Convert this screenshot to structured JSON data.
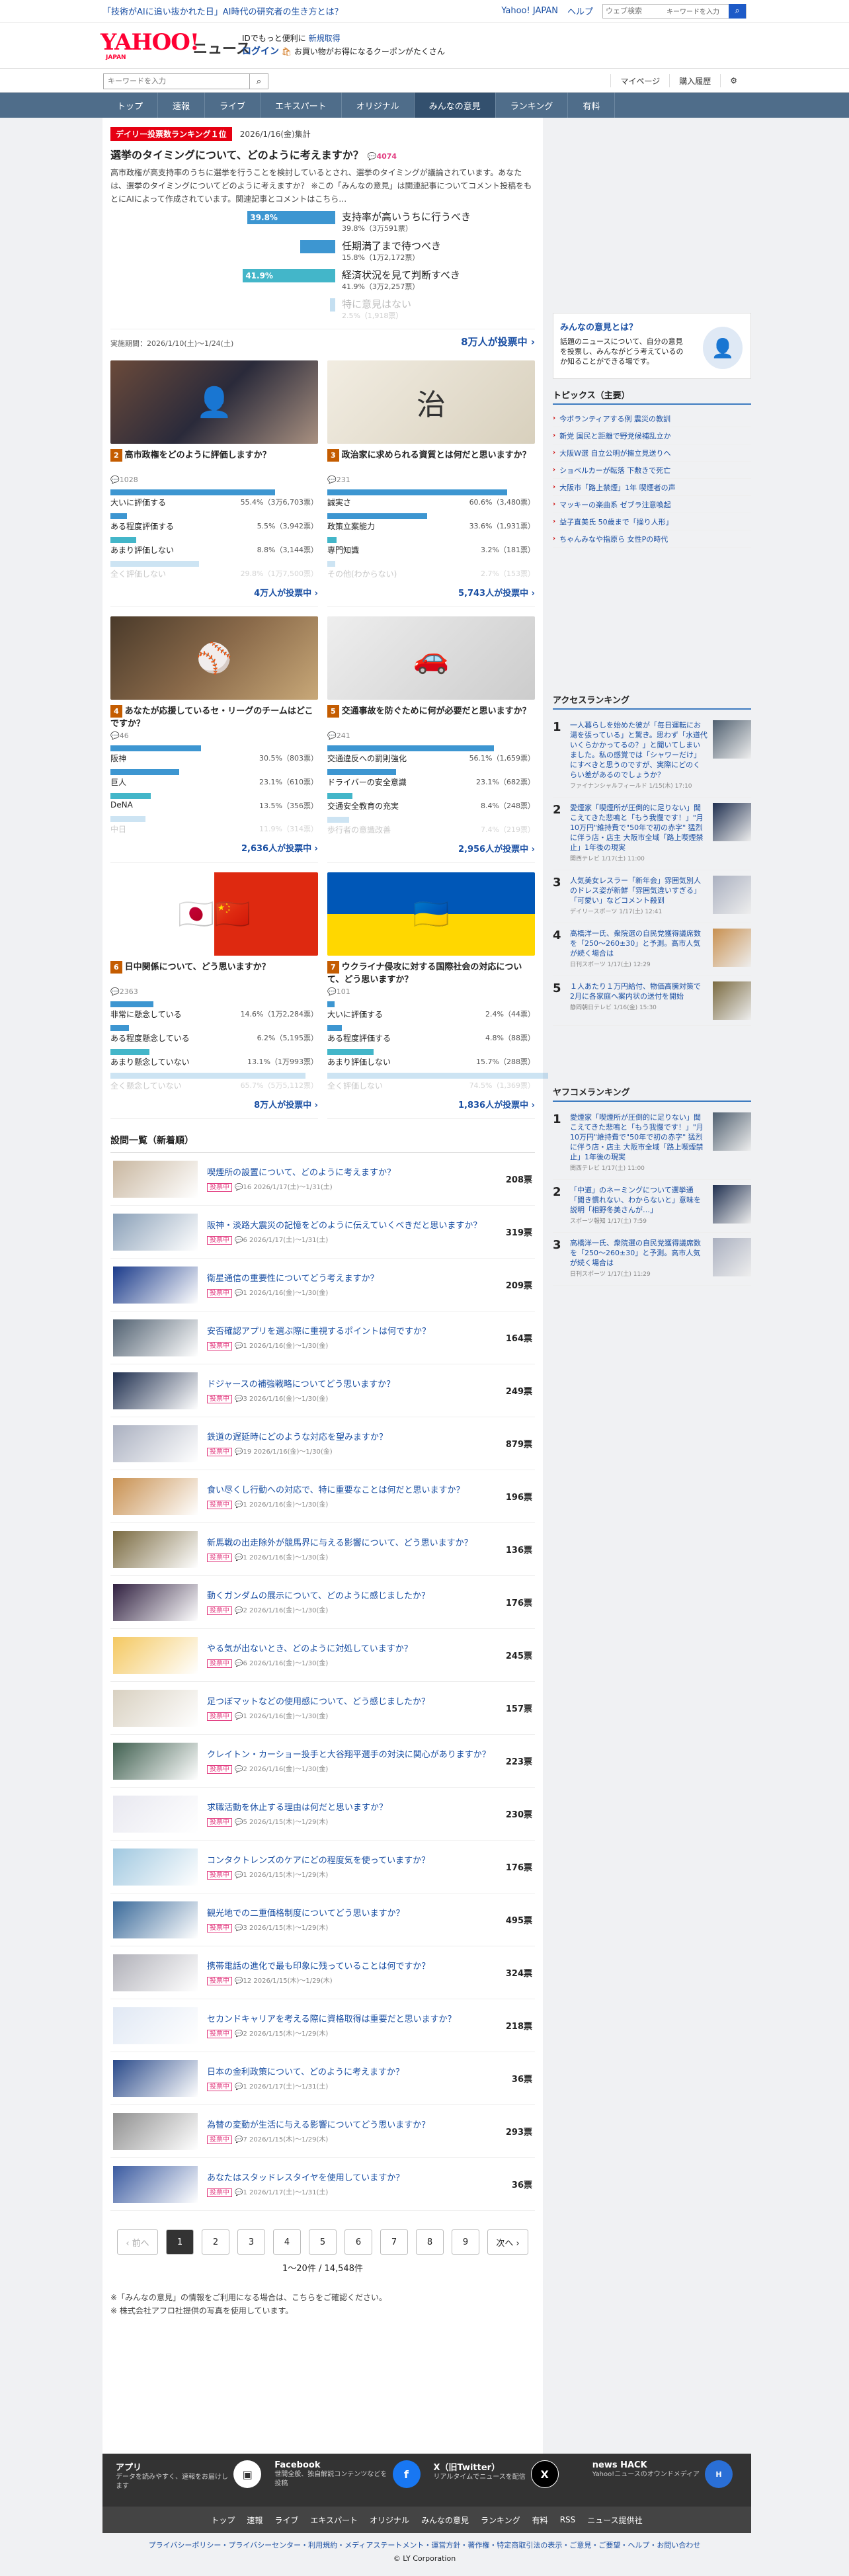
{
  "topbar": {
    "notice": "「技術がAIに追い抜かれた日」AI時代の研究者の生き方とは？",
    "japan": "Yahoo! JAPAN",
    "help": "ヘルプ",
    "search_placeholder": "ウェブ検索",
    "search_keyword": "キーワードを入力"
  },
  "header": {
    "logo": "YAHOO!",
    "logo_sub": "JAPAN",
    "news": "ニュース",
    "promo1": "IDでもっと便利に",
    "promo_new": "新規取得",
    "login": "ログイン",
    "promo2": "お買い物がお得になるクーポンがたくさん"
  },
  "searchbar": {
    "placeholder": "キーワードを入力",
    "mypage": "マイページ",
    "history": "購入履歴"
  },
  "nav": [
    "トップ",
    "速報",
    "ライブ",
    "エキスパート",
    "オリジナル",
    "みんなの意見",
    "ランキング",
    "有料"
  ],
  "feature": {
    "tag": "デイリー投票数ランキング１位",
    "date": "2026/1/16(金)集計",
    "title": "選挙のタイミングについて、どのように考えますか？",
    "comments": "4074",
    "description": "高市政権が高支持率のうちに選挙を行うことを検討しているとされ、選挙のタイミングが議論されています。あなたは、選挙のタイミングについてどのように考えますか？ ※この「みんなの意見」は関連記事についてコメント投稿をもとにAIによって作成されています。関連記事とコメントはこちら…",
    "options": [
      {
        "label": "支持率が高いうちに行うべき",
        "pct": 39.8,
        "pct_label": "39.8%",
        "value": "39.8%（3万591票）"
      },
      {
        "label": "任期満了まで待つべき",
        "pct": 15.8,
        "pct_label": "",
        "value": "15.8%（1万2,172票）"
      },
      {
        "label": "経済状況を見て判断すべき",
        "pct": 41.9,
        "pct_label": "41.9%",
        "value": "41.9%（3万2,257票）"
      },
      {
        "label": "特に意見はない",
        "pct": 2.5,
        "pct_label": "",
        "value": "2.5%（1,918票）"
      }
    ],
    "period": "実施期間：2026/1/10(土)〜1/24(土)",
    "votes": "8万人が投票中 ›"
  },
  "cards": [
    {
      "rank": "2",
      "title": "高市政権をどのように評価しますか？",
      "cmt": "1028",
      "opts": [
        {
          "l": "大いに評価する",
          "v": "55.4%（3万6,703票）",
          "p": 55.4
        },
        {
          "l": "ある程度評価する",
          "v": "5.5%（3,942票）",
          "p": 5.5
        },
        {
          "l": "あまり評価しない",
          "v": "8.8%（3,144票）",
          "p": 8.8
        },
        {
          "l": "全く評価しない",
          "v": "29.8%（1万7,500票）",
          "p": 29.8
        }
      ],
      "votes": "4万人が投票中 ›"
    },
    {
      "rank": "3",
      "title": "政治家に求められる資質とは何だと思いますか？",
      "cmt": "231",
      "opts": [
        {
          "l": "誠実さ",
          "v": "60.6%（3,480票）",
          "p": 60.6
        },
        {
          "l": "政策立案能力",
          "v": "33.6%（1,931票）",
          "p": 33.6
        },
        {
          "l": "専門知識",
          "v": "3.2%（181票）",
          "p": 3.2
        },
        {
          "l": "その他(わからない)",
          "v": "2.7%（153票）",
          "p": 2.7
        }
      ],
      "votes": "5,743人が投票中 ›"
    },
    {
      "rank": "4",
      "title": "あなたが応援しているセ・リーグのチームはどこですか？",
      "cmt": "46",
      "opts": [
        {
          "l": "阪神",
          "v": "30.5%（803票）",
          "p": 30.5
        },
        {
          "l": "巨人",
          "v": "23.1%（610票）",
          "p": 23.1
        },
        {
          "l": "DeNA",
          "v": "13.5%（356票）",
          "p": 13.5
        },
        {
          "l": "中日",
          "v": "11.9%（314票）",
          "p": 11.9
        }
      ],
      "votes": "2,636人が投票中 ›"
    },
    {
      "rank": "5",
      "title": "交通事故を防ぐために何が必要だと思いますか？",
      "cmt": "241",
      "opts": [
        {
          "l": "交通違反への罰則強化",
          "v": "56.1%（1,659票）",
          "p": 56.1
        },
        {
          "l": "ドライバーの安全意識",
          "v": "23.1%（682票）",
          "p": 23.1
        },
        {
          "l": "交通安全教育の充実",
          "v": "8.4%（248票）",
          "p": 8.4
        },
        {
          "l": "歩行者の意識改善",
          "v": "7.4%（219票）",
          "p": 7.4
        }
      ],
      "votes": "2,956人が投票中 ›"
    },
    {
      "rank": "6",
      "title": "日中関係について、どう思いますか？",
      "cmt": "2363",
      "opts": [
        {
          "l": "非常に懸念している",
          "v": "14.6%（1万2,284票）",
          "p": 14.6
        },
        {
          "l": "ある程度懸念している",
          "v": "6.2%（5,195票）",
          "p": 6.2
        },
        {
          "l": "あまり懸念していない",
          "v": "13.1%（1万993票）",
          "p": 13.1
        },
        {
          "l": "全く懸念していない",
          "v": "65.7%（5万5,112票）",
          "p": 65.7
        }
      ],
      "votes": "8万人が投票中 ›"
    },
    {
      "rank": "7",
      "title": "ウクライナ侵攻に対する国際社会の対応について、どう思いますか？",
      "cmt": "101",
      "opts": [
        {
          "l": "大いに評価する",
          "v": "2.4%（44票）",
          "p": 2.4
        },
        {
          "l": "ある程度評価する",
          "v": "4.8%（88票）",
          "p": 4.8
        },
        {
          "l": "あまり評価しない",
          "v": "15.7%（288票）",
          "p": 15.7
        },
        {
          "l": "全く評価しない",
          "v": "74.5%（1,369票）",
          "p": 74.5
        }
      ],
      "votes": "1,836人が投票中 ›"
    }
  ],
  "list": {
    "header": "設問一覧（新着順）",
    "items": [
      {
        "t": "喫煙所の設置について、どのように考えますか？",
        "m": "16 2026/1/17(土)〜1/31(土)",
        "v": "208票"
      },
      {
        "t": "阪神・淡路大震災の記憶をどのように伝えていくべきだと思いますか？",
        "m": "6 2026/1/17(土)〜1/31(土)",
        "v": "319票"
      },
      {
        "t": "衛星通信の重要性についてどう考えますか？",
        "m": "1 2026/1/16(金)〜1/30(金)",
        "v": "209票"
      },
      {
        "t": "安否確認アプリを選ぶ際に重視するポイントは何ですか？",
        "m": "1 2026/1/16(金)〜1/30(金)",
        "v": "164票"
      },
      {
        "t": "ドジャースの補強戦略についてどう思いますか？",
        "m": "3 2026/1/16(金)〜1/30(金)",
        "v": "249票"
      },
      {
        "t": "鉄道の遅延時にどのような対応を望みますか？",
        "m": "19 2026/1/16(金)〜1/30(金)",
        "v": "879票"
      },
      {
        "t": "食い尽くし行動への対応で、特に重要なことは何だと思いますか？",
        "m": "1 2026/1/16(金)〜1/30(金)",
        "v": "196票"
      },
      {
        "t": "新馬戦の出走除外が競馬界に与える影響について、どう思いますか？",
        "m": "1 2026/1/16(金)〜1/30(金)",
        "v": "136票"
      },
      {
        "t": "動くガンダムの展示について、どのように感じましたか？",
        "m": "2 2026/1/16(金)〜1/30(金)",
        "v": "176票"
      },
      {
        "t": "やる気が出ないとき、どのように対処していますか？",
        "m": "6 2026/1/16(金)〜1/30(金)",
        "v": "245票"
      },
      {
        "t": "足つぼマットなどの使用感について、どう感じましたか？",
        "m": "1 2026/1/16(金)〜1/30(金)",
        "v": "157票"
      },
      {
        "t": "クレイトン・カーショー投手と大谷翔平選手の対決に関心がありますか？",
        "m": "2 2026/1/16(金)〜1/30(金)",
        "v": "223票"
      },
      {
        "t": "求職活動を休止する理由は何だと思いますか？",
        "m": "5 2026/1/15(木)〜1/29(木)",
        "v": "230票"
      },
      {
        "t": "コンタクトレンズのケアにどの程度気を使っていますか？",
        "m": "1 2026/1/15(木)〜1/29(木)",
        "v": "176票"
      },
      {
        "t": "観光地での二重価格制度についてどう思いますか？",
        "m": "3 2026/1/15(木)〜1/29(木)",
        "v": "495票"
      },
      {
        "t": "携帯電話の進化で最も印象に残っていることは何ですか？",
        "m": "12 2026/1/15(木)〜1/29(木)",
        "v": "324票"
      },
      {
        "t": "セカンドキャリアを考える際に資格取得は重要だと思いますか？",
        "m": "2 2026/1/15(木)〜1/29(木)",
        "v": "218票"
      },
      {
        "t": "日本の金利政策について、どのように考えますか？",
        "m": "1 2026/1/17(土)〜1/31(土)",
        "v": "36票"
      },
      {
        "t": "為替の変動が生活に与える影響についてどう思いますか？",
        "m": "7 2026/1/15(木)〜1/29(木)",
        "v": "293票"
      },
      {
        "t": "あなたはスタッドレスタイヤを使用していますか？",
        "m": "1 2026/1/17(土)〜1/31(土)",
        "v": "36票"
      }
    ],
    "status": "投票中"
  },
  "pager": {
    "prev": "‹ 前へ",
    "pages": [
      "1",
      "2",
      "3",
      "4",
      "5",
      "6",
      "7",
      "8",
      "9"
    ],
    "next": "次へ ›",
    "count": "1〜20件 / 14,548件"
  },
  "notes": [
    "※「みんなの意見」の情報をご利用になる場合は、こちらをご確認ください。",
    "※ 株式会社アフロ社提供の写真を使用しています。"
  ],
  "side": {
    "about_title": "みんなの意見とは？",
    "about_text": "話題のニュースについて、自分の意見を投票し、みんながどう考えているのか知ることができる場です。",
    "topics_title": "トピックス（主要）",
    "topics": [
      "今ボランティアする例 震災の教訓",
      "新党 国民と距離で野党候補乱立か",
      "大阪W選 自立公明が擁立見送りへ",
      "ショベルカーが転落 下敷きで死亡",
      "大阪市「路上禁煙」1年 喫煙者の声",
      "マッキーの楽曲系 ゼブラ注意喚起",
      "益子直美氏 50歳まで「操り人形」",
      "ちゃんみなや指原ら 女性Pの時代"
    ],
    "access_title": "アクセスランキング",
    "access": [
      {
        "t": "一人暮らしを始めた彼が「毎日運転にお湯を張っている」と驚き。思わず「水道代いくらかかってるの？」と聞いてしまいました。私の感覚では「シャワーだけ」にすべきと思うのですが、実際にどのくらい差があるのでしょうか？",
        "m": "ファイナンシャルフィールド 1/15(木) 17:10"
      },
      {
        "t": "愛煙家「喫煙所が圧倒的に足りない」聞こえてきた悲鳴と「もう我慢です！」\"月10万円\"維持費で\"50年で初の赤字\" 猛烈に伴う店・店主 大阪市全域「路上喫煙禁止」1年後の現実",
        "m": "関西テレビ 1/17(土) 11:00"
      },
      {
        "t": "人気美女レスラー「新年会」雰囲気別人のドレス姿が新鮮「雰囲気違いすぎる」「可愛い」などコメント殺到",
        "m": "デイリースポーツ 1/17(土) 12:41"
      },
      {
        "t": "高橋洋一氏、衆院選の自民党獲得議席数を「250〜260±30」と予測。高市人気が続く場合は",
        "m": "日刊スポーツ 1/17(土) 12:29"
      },
      {
        "t": "１人あたり１万円給付、物価高騰対策で 2月に各家庭へ案内状の送付を開始",
        "m": "静岡朝日テレビ 1/16(金) 15:30"
      }
    ],
    "yafuko_title": "ヤフコメランキング",
    "yafuko": [
      {
        "t": "愛煙家「喫煙所が圧倒的に足りない」聞こえてきた悲鳴と「もう我慢です！」\"月10万円\"維持費で\"50年で初の赤字\" 猛烈に伴う店・店主 大阪市全域「路上喫煙禁止」1年後の現実",
        "m": "関西テレビ 1/17(土) 11:00"
      },
      {
        "t": "「中道」のネーミングについて選挙通「聞き慣れない、わからないと」意味を説明「相野冬美さんが…」",
        "m": "スポーツ報知 1/17(土) 7:59"
      },
      {
        "t": "高橋洋一氏、衆院選の自民党獲得議席数を「250〜260±30」と予測。高市人気が続く場合は",
        "m": "日刊スポーツ 1/17(土) 11:29"
      }
    ]
  },
  "footer": {
    "cols": [
      {
        "t": "アプリ",
        "d": "データを読みやすく、速報をお届けします"
      },
      {
        "t": "Facebook",
        "d": "世間全般、独自解説コンテンツなどを投稿"
      },
      {
        "t": "X（旧Twitter）",
        "d": "リアルタイムでニュースを配信"
      },
      {
        "t": "news HACK",
        "d": "Yahoo!ニュースのオウンドメディア"
      }
    ],
    "nav": [
      "トップ",
      "速報",
      "ライブ",
      "エキスパート",
      "オリジナル",
      "みんなの意見",
      "ランキング",
      "有料",
      "RSS",
      "ニュース提供社"
    ],
    "links": "プライバシーポリシー・プライバシーセンター・利用規約・メディアステートメント・運営方針・著作権・特定商取引法の表示・ご意見・ご要望・ヘルプ・お問い合わせ",
    "copy": "© LY Corporation"
  }
}
